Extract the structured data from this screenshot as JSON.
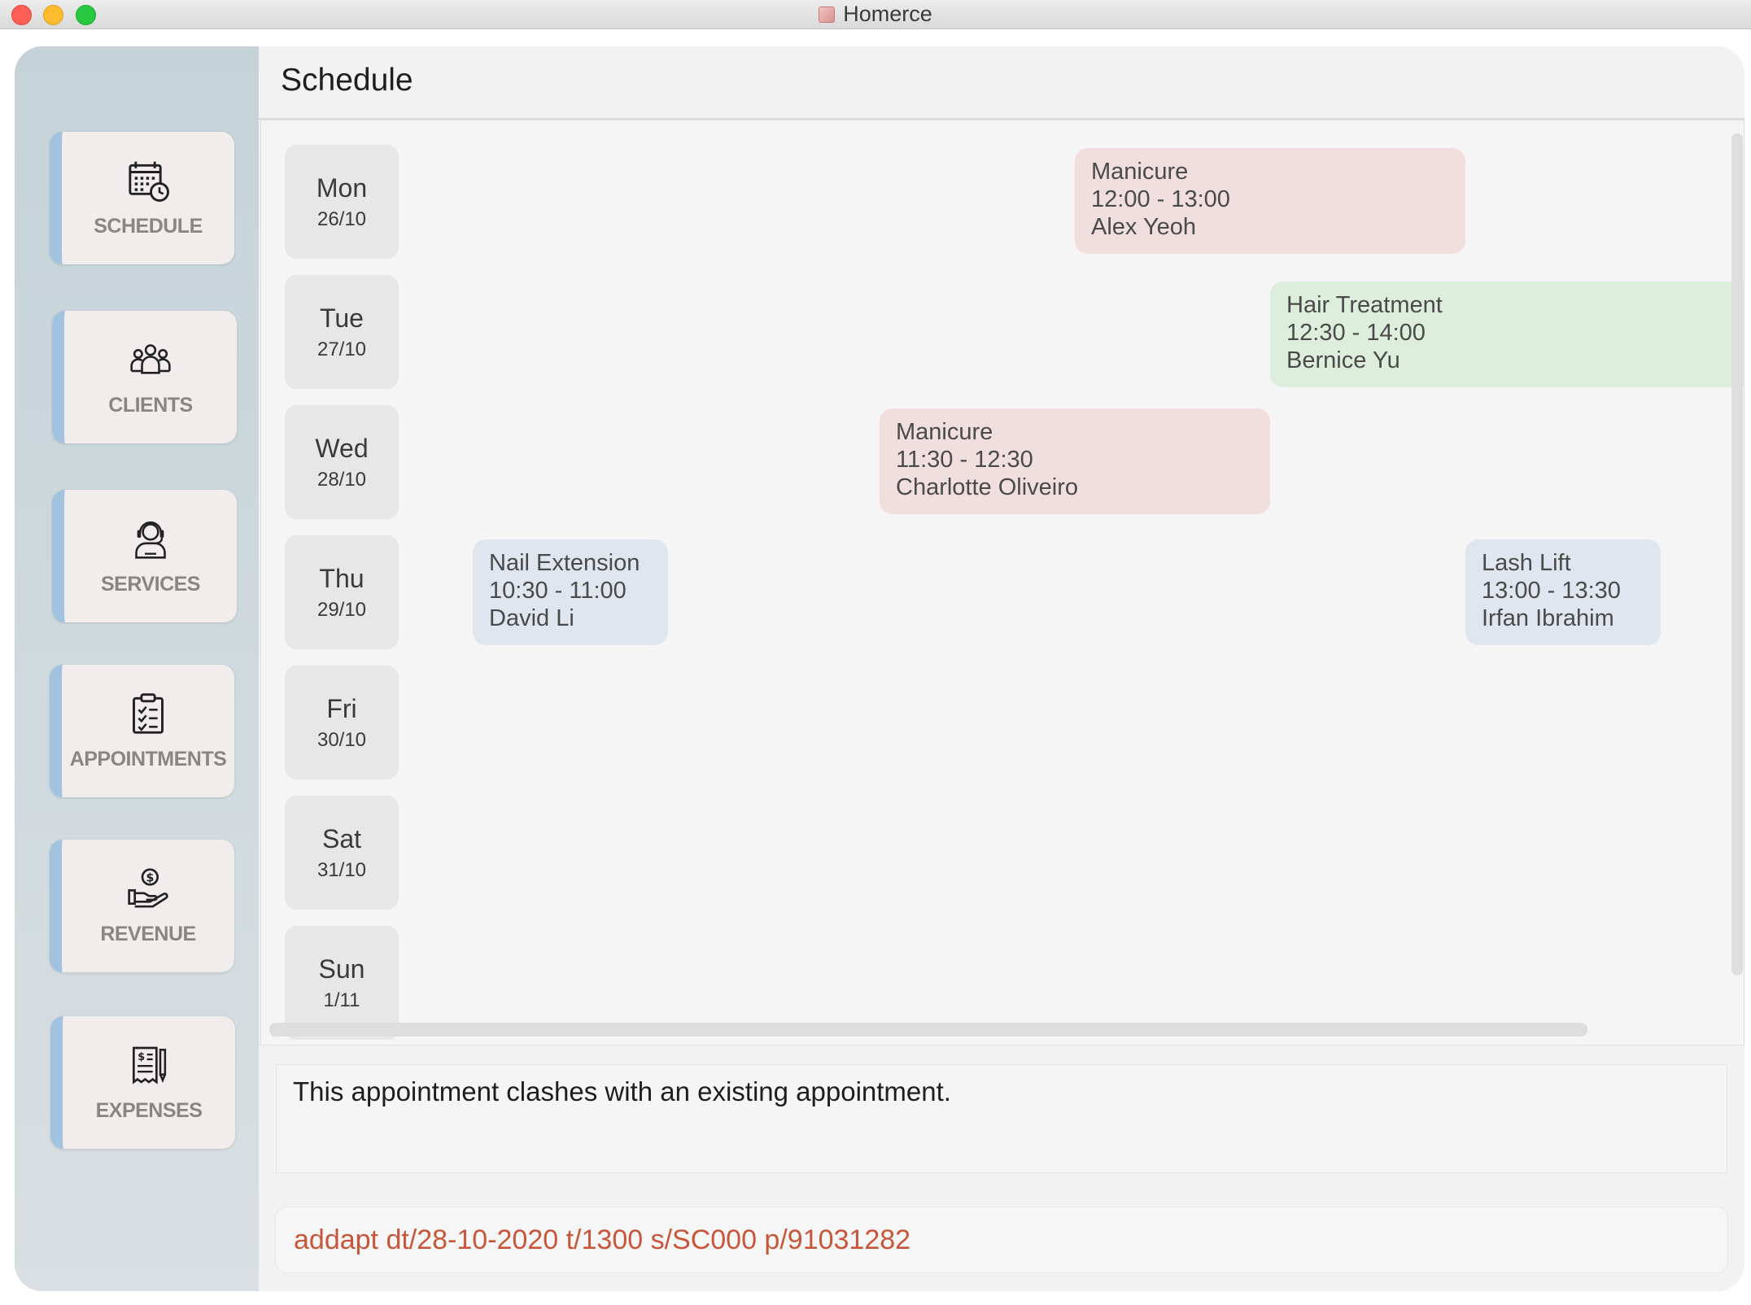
{
  "window": {
    "title": "Homerce"
  },
  "sidebar": {
    "items": [
      {
        "label": "SCHEDULE",
        "icon": "calendar-clock-icon"
      },
      {
        "label": "CLIENTS",
        "icon": "people-icon"
      },
      {
        "label": "SERVICES",
        "icon": "headset-person-icon"
      },
      {
        "label": "APPOINTMENTS",
        "icon": "clipboard-check-icon"
      },
      {
        "label": "REVENUE",
        "icon": "hand-coin-icon"
      },
      {
        "label": "EXPENSES",
        "icon": "receipt-pen-icon"
      }
    ]
  },
  "main": {
    "title": "Schedule"
  },
  "schedule": {
    "days": [
      {
        "name": "Mon",
        "date": "26/10"
      },
      {
        "name": "Tue",
        "date": "27/10"
      },
      {
        "name": "Wed",
        "date": "28/10"
      },
      {
        "name": "Thu",
        "date": "29/10"
      },
      {
        "name": "Fri",
        "date": "30/10"
      },
      {
        "name": "Sat",
        "date": "31/10"
      },
      {
        "name": "Sun",
        "date": "1/11"
      }
    ],
    "appointments": [
      {
        "service": "Manicure",
        "time": "12:00 - 13:00",
        "client": "Alex Yeoh",
        "color": "#f1dfdf"
      },
      {
        "service": "Hair Treatment",
        "time": "12:30 - 14:00",
        "client": "Bernice Yu",
        "color": "#ddeedd"
      },
      {
        "service": "Manicure",
        "time": "11:30 - 12:30",
        "client": "Charlotte Oliveiro",
        "color": "#f1dfdf"
      },
      {
        "service": "Nail Extension",
        "time": "10:30 - 11:00",
        "client": "David Li",
        "color": "#e0e6ef"
      },
      {
        "service": "Lash Lift",
        "time": "13:00 - 13:30",
        "client": "Irfan Ibrahim",
        "color": "#e0e6ef"
      }
    ]
  },
  "result": {
    "message": "This appointment clashes with an existing appointment."
  },
  "command": {
    "value": "addapt dt/28-10-2020 t/1300 s/SC000 p/91031282",
    "color": "#c8563b"
  },
  "colors": {
    "nav_accent": "#a2c3df",
    "sidebar_bg": "#cfd9dd"
  }
}
